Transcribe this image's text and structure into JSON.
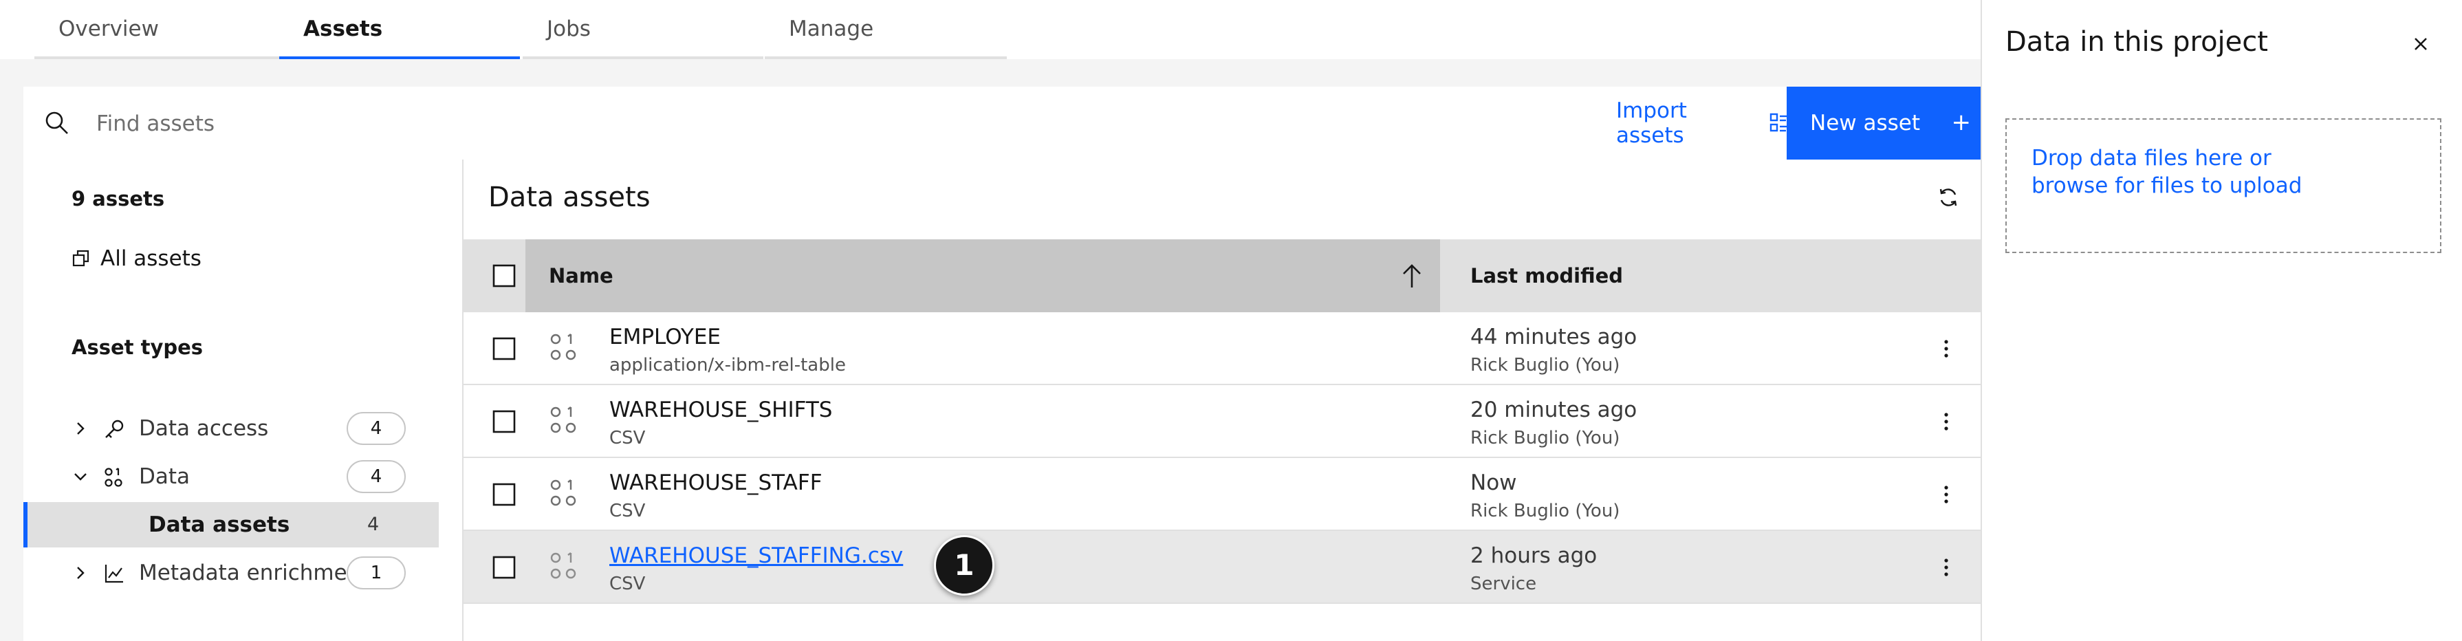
{
  "tabs": [
    {
      "label": "Overview"
    },
    {
      "label": "Assets"
    },
    {
      "label": "Jobs"
    },
    {
      "label": "Manage"
    }
  ],
  "search": {
    "placeholder": "Find assets",
    "value": ""
  },
  "toolbar": {
    "import_label": "Import assets",
    "new_asset_label": "New asset",
    "new_asset_icon": "+"
  },
  "sidebar": {
    "count_title": "9 assets",
    "all_assets_label": "All assets",
    "types_title": "Asset types",
    "types": [
      {
        "label": "Data access",
        "count": "4",
        "icon": "key-icon",
        "expanded": false
      },
      {
        "label": "Data",
        "count": "4",
        "icon": "data-icon",
        "expanded": true
      },
      {
        "label": "Data assets",
        "count": "4",
        "selected": true
      },
      {
        "label": "Metadata enrichment",
        "count": "1",
        "icon": "chart-icon",
        "expanded": false
      }
    ]
  },
  "main": {
    "title": "Data assets",
    "columns": {
      "name": "Name",
      "modified": "Last modified"
    },
    "rows": [
      {
        "name": "EMPLOYEE",
        "type": "application/x-ibm-rel-table",
        "modified": "44 minutes ago",
        "by": "Rick Buglio (You)"
      },
      {
        "name": "WAREHOUSE_SHIFTS",
        "type": "CSV",
        "modified": "20 minutes ago",
        "by": "Rick Buglio (You)"
      },
      {
        "name": "WAREHOUSE_STAFF",
        "type": "CSV",
        "modified": "Now",
        "by": "Rick Buglio (You)"
      },
      {
        "name": "WAREHOUSE_STAFFING.csv",
        "type": "CSV",
        "modified": "2 hours ago",
        "by": "Service",
        "hovered": true
      }
    ],
    "callout": "1"
  },
  "right_panel": {
    "title": "Data in this project",
    "drop_line1": "Drop data files here or",
    "drop_line2": "browse for files to upload"
  },
  "colors": {
    "accent": "#0f62fe",
    "header_bg": "#e0e0e0",
    "sorted_header_bg": "#c6c6c6",
    "page_bg": "#f4f4f4"
  }
}
